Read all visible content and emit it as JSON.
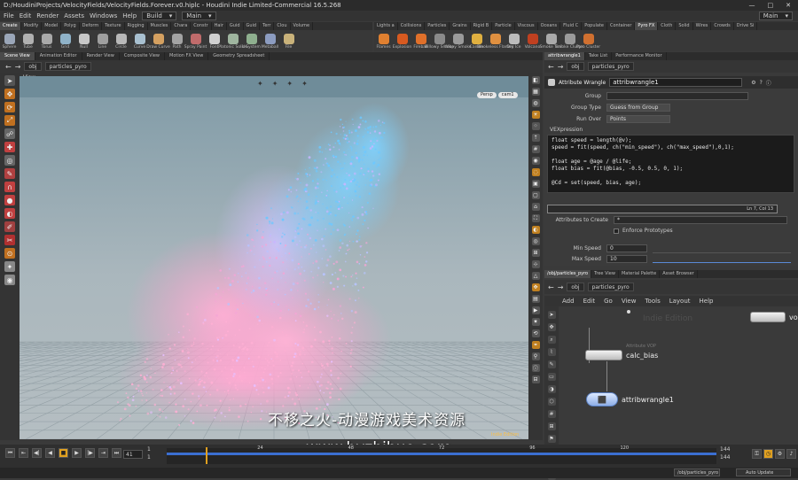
{
  "window": {
    "title": "D:/HoudiniProjects/VelocityFields/VelocityFields.Forever.v0.hiplc - Houdini Indie Limited-Commercial 16.5.268",
    "controls": [
      "—",
      "□",
      "✕"
    ]
  },
  "menubar": {
    "items": [
      "File",
      "Edit",
      "Render",
      "Assets",
      "Windows",
      "Help"
    ],
    "build_label": "Build",
    "desk_label": "Main",
    "right_label": "Main"
  },
  "shelf_left": {
    "tabs": [
      "Create",
      "Modify",
      "Model",
      "Polyg",
      "Deform",
      "Texture",
      "Rigging",
      "Muscles",
      "Chara",
      "Constr",
      "Hair",
      "Guid",
      "Guid",
      "Terr",
      "Clou",
      "Volume"
    ],
    "tools": [
      {
        "label": "Sphere",
        "icon": "sphere-icon"
      },
      {
        "label": "Tube",
        "icon": "tube-icon"
      },
      {
        "label": "Torus",
        "icon": "torus-icon"
      },
      {
        "label": "Grid",
        "icon": "grid-icon"
      },
      {
        "label": "Null",
        "icon": "null-icon"
      },
      {
        "label": "Line",
        "icon": "line-icon"
      },
      {
        "label": "Circle",
        "icon": "circle-icon"
      },
      {
        "label": "Curve",
        "icon": "curve-icon"
      },
      {
        "label": "Draw Curve",
        "icon": "draw-curve-icon"
      },
      {
        "label": "Path",
        "icon": "path-icon"
      },
      {
        "label": "Spray Paint",
        "icon": "spray-paint-icon"
      },
      {
        "label": "Font",
        "icon": "font-icon"
      },
      {
        "label": "Platonic Solids",
        "icon": "platonic-icon"
      },
      {
        "label": "L-System",
        "icon": "lsystem-icon"
      },
      {
        "label": "Metaball",
        "icon": "metaball-icon"
      },
      {
        "label": "File",
        "icon": "file-icon"
      }
    ]
  },
  "shelf_right": {
    "tabs": [
      "Lights a",
      "Collisions",
      "Particles",
      "Grains",
      "Rigid B",
      "Particle",
      "Viscous",
      "Oceans",
      "Fluid C",
      "Populate",
      "Container",
      "Pyro FX",
      "Cloth",
      "Solid",
      "Wires",
      "Crowds",
      "Drive Si"
    ],
    "active_tab": "Pyro FX",
    "tools": [
      {
        "label": "Flames",
        "icon": "flames-icon"
      },
      {
        "label": "Explosion",
        "icon": "explosion-icon"
      },
      {
        "label": "Fireball",
        "icon": "fireball-icon"
      },
      {
        "label": "Billowy Smoke",
        "icon": "billowy-smoke-icon"
      },
      {
        "label": "Wispy Smoke",
        "icon": "wispy-smoke-icon"
      },
      {
        "label": "Candle",
        "icon": "candle-icon"
      },
      {
        "label": "Smokeless Flames",
        "icon": "smokeless-flames-icon"
      },
      {
        "label": "Dry Ice",
        "icon": "dry-ice-icon"
      },
      {
        "label": "Volcano",
        "icon": "volcano-icon"
      },
      {
        "label": "Smoke Trail",
        "icon": "smoke-trail-icon"
      },
      {
        "label": "Smoke Cluster",
        "icon": "smoke-cluster-icon"
      },
      {
        "label": "Pyro Cluster",
        "icon": "pyro-cluster-icon"
      }
    ]
  },
  "pane_tabs_left": [
    "Scene View",
    "Animation Editor",
    "Render View",
    "Composite View",
    "Motion FX View",
    "Geometry Spreadsheet"
  ],
  "path_left": {
    "obj": "obj",
    "node": "particles_pyro"
  },
  "viewport": {
    "label": "View",
    "camera_persp": "Persp",
    "camera_name": "cam1",
    "indie_label": "Indie Edition"
  },
  "watermark": {
    "line1": "不移之火-动漫游戏美术资源",
    "line2": "www.byzhihuo.com"
  },
  "timeline": {
    "current_frame": "41",
    "start_a": "1",
    "start_b": "1",
    "ticks": [
      "24",
      "48",
      "72",
      "96",
      "120"
    ],
    "end_a": "144",
    "end_b": "144",
    "range_fraction": 1.0
  },
  "statusbar": {
    "path": "/obj/particles_pyro",
    "auto_update": "Auto Update"
  },
  "parm_pane": {
    "tabs": [
      "attribwrangle1",
      "Take List",
      "Performance Monitor"
    ],
    "path_obj": "obj",
    "path_node": "particles_pyro",
    "node_type": "Attribute Wrangle",
    "node_name": "attribwrangle1",
    "group_label": "Group",
    "group_value": "",
    "group_type_label": "Group Type",
    "group_type_value": "Guess from Group",
    "run_over_label": "Run Over",
    "run_over_value": "Points",
    "vex_label": "VEXpression",
    "code_lines": [
      "float speed = length(@v);",
      "speed = fit(speed, ch(\"min_speed\"), ch(\"max_speed\"),0,1);",
      "",
      "float age = @age / @life;",
      "float bias = fit(@bias, -0.5, 0.5, 0, 1);",
      "",
      "@Cd = set(speed, bias, age);"
    ],
    "cursor_status": "Ln 7, Col 13",
    "attrs_label": "Attributes to Create",
    "attrs_value": "*",
    "enforce_label": "Enforce Prototypes",
    "min_speed_label": "Min Speed",
    "min_speed_value": "0",
    "max_speed_label": "Max Speed",
    "max_speed_value": "10"
  },
  "network": {
    "tabs": [
      "/obj/particles_pyro",
      "Tree View",
      "Material Palette",
      "Asset Browser"
    ],
    "path_obj": "obj",
    "path_node": "particles_pyro",
    "menu": [
      "Add",
      "Edit",
      "Go",
      "View",
      "Tools",
      "Layout",
      "Help"
    ],
    "indie_label": "Indie Edition",
    "node_top_right": "vol",
    "node_bias_sub": "Attribute VOP",
    "node_bias_name": "calc_bias",
    "node_wrangle_name": "attribwrangle1"
  },
  "colors": {
    "accent": "#e0a020",
    "timeline_range": "#3b6fd1",
    "background": "#3a3a3a"
  }
}
